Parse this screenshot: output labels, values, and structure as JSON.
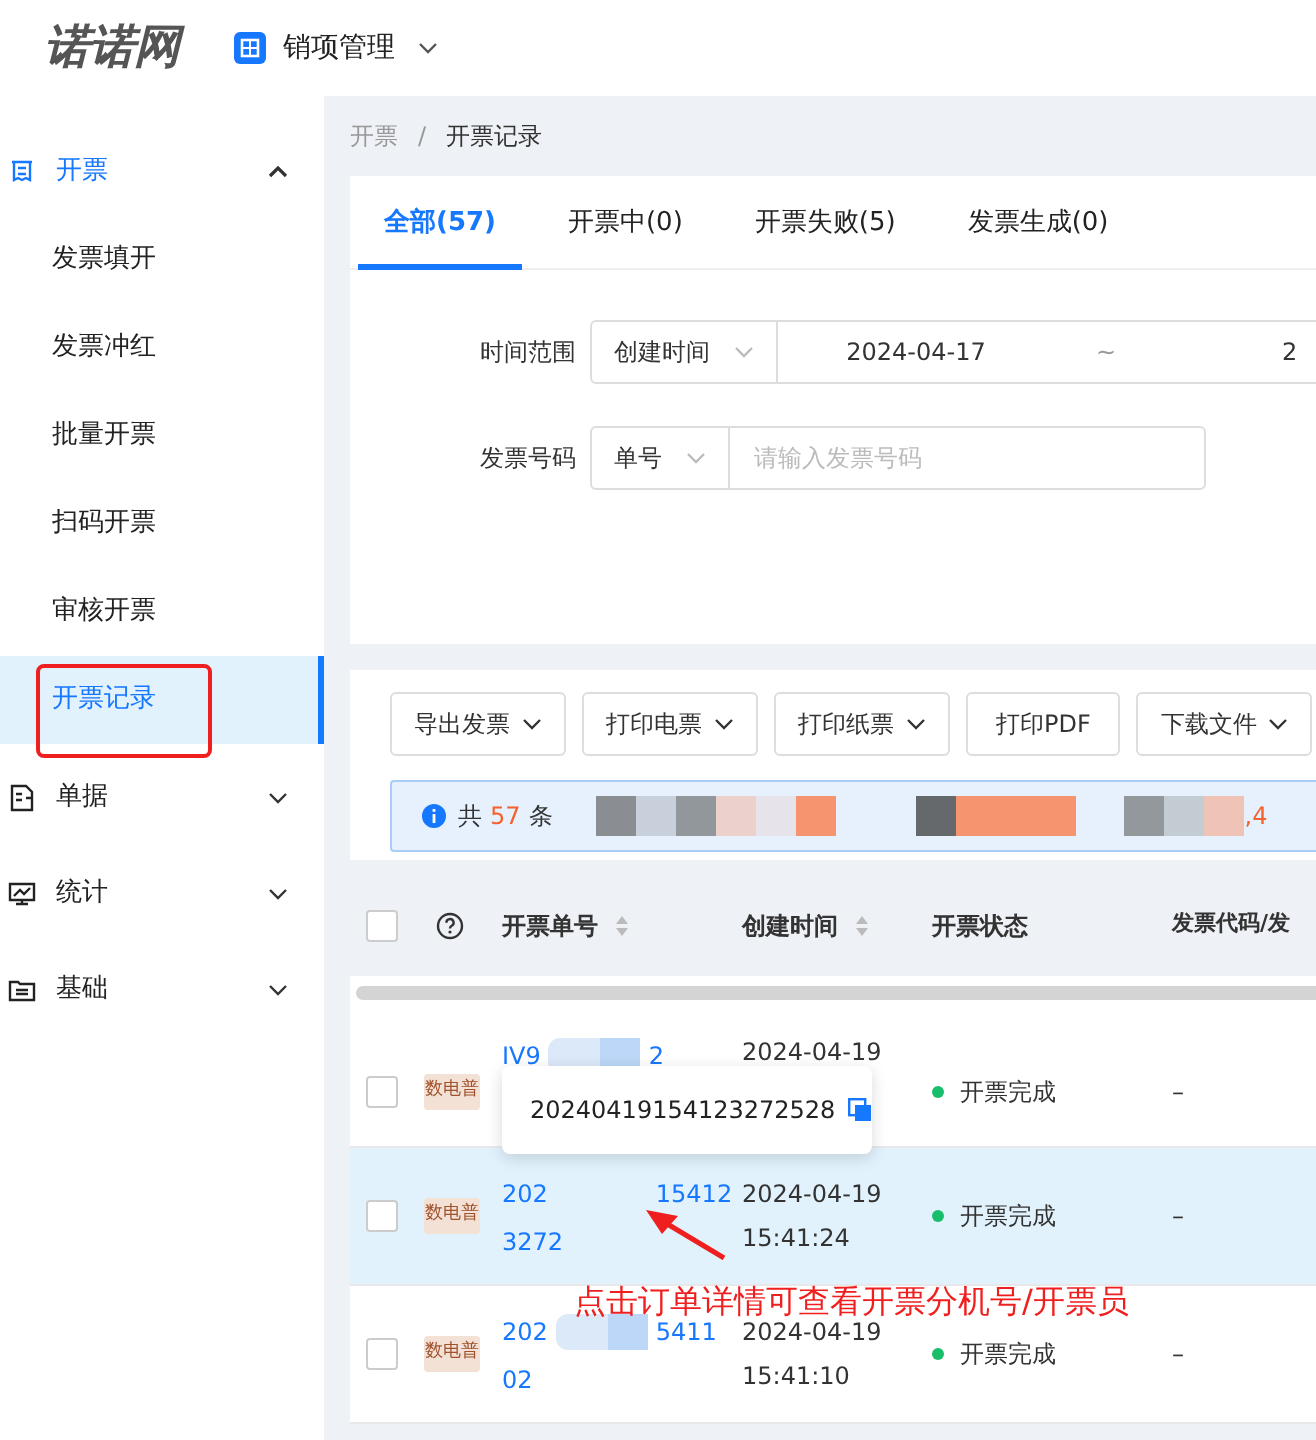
{
  "header": {
    "logo": "诺诺网",
    "app_switcher": "销项管理"
  },
  "sidebar": {
    "items": [
      {
        "label": "开票",
        "expanded": true,
        "children": [
          {
            "label": "发票填开",
            "selected": false
          },
          {
            "label": "发票冲红",
            "selected": false
          },
          {
            "label": "批量开票",
            "selected": false
          },
          {
            "label": "扫码开票",
            "selected": false
          },
          {
            "label": "审核开票",
            "selected": false
          },
          {
            "label": "开票记录",
            "selected": true
          }
        ]
      },
      {
        "label": "单据",
        "expanded": false
      },
      {
        "label": "统计",
        "expanded": false
      },
      {
        "label": "基础",
        "expanded": false
      }
    ]
  },
  "breadcrumb": {
    "items": [
      "开票",
      "开票记录"
    ],
    "separator": "/"
  },
  "tabs": [
    {
      "label": "全部(57)",
      "selected": true
    },
    {
      "label": "开票中(0)",
      "selected": false
    },
    {
      "label": "开票失败(5)",
      "selected": false
    },
    {
      "label": "发票生成(0)",
      "selected": false
    }
  ],
  "filters": [
    {
      "label": "时间范围",
      "select": "创建时间",
      "start": "2024-04-17",
      "separator": "~",
      "end": "2"
    },
    {
      "label": "发票号码",
      "select": "单号",
      "placeholder": "请输入发票号码"
    }
  ],
  "toolbar": [
    {
      "label": "导出发票",
      "dropdown": true
    },
    {
      "label": "打印电票",
      "dropdown": true
    },
    {
      "label": "打印纸票",
      "dropdown": true
    },
    {
      "label": "打印PDF",
      "dropdown": false
    },
    {
      "label": "下载文件",
      "dropdown": true
    }
  ],
  "info_bar": {
    "prefix": "共",
    "count": "57",
    "suffix": "条",
    "tail": ",4"
  },
  "table": {
    "select_all_checked": false,
    "columns": [
      "开票单号",
      "创建时间",
      "开票状态",
      "发票代码/发"
    ],
    "rows": [
      {
        "checked": false,
        "tag": "数电普",
        "order_lines": [
          [
            "IV9",
            "2"
          ]
        ],
        "created": [
          "2024-04-19"
        ],
        "status": "开票完成",
        "code": "–",
        "selected": false
      },
      {
        "checked": false,
        "tag": "数电普",
        "order_lines": [
          [
            "202",
            "15412"
          ],
          [
            "3272"
          ]
        ],
        "created": [
          "2024-04-19",
          "15:41:24"
        ],
        "status": "开票完成",
        "code": "–",
        "selected": true
      },
      {
        "checked": false,
        "tag": "数电普",
        "order_lines": [
          [
            "202",
            "5411"
          ],
          [
            "02"
          ]
        ],
        "created": [
          "2024-04-19",
          "15:41:10"
        ],
        "status": "开票完成",
        "code": "–",
        "selected": false
      }
    ]
  },
  "tooltip": "20240419154123272528",
  "annotation": "点击订单详情可查看开票分机号/开票员"
}
